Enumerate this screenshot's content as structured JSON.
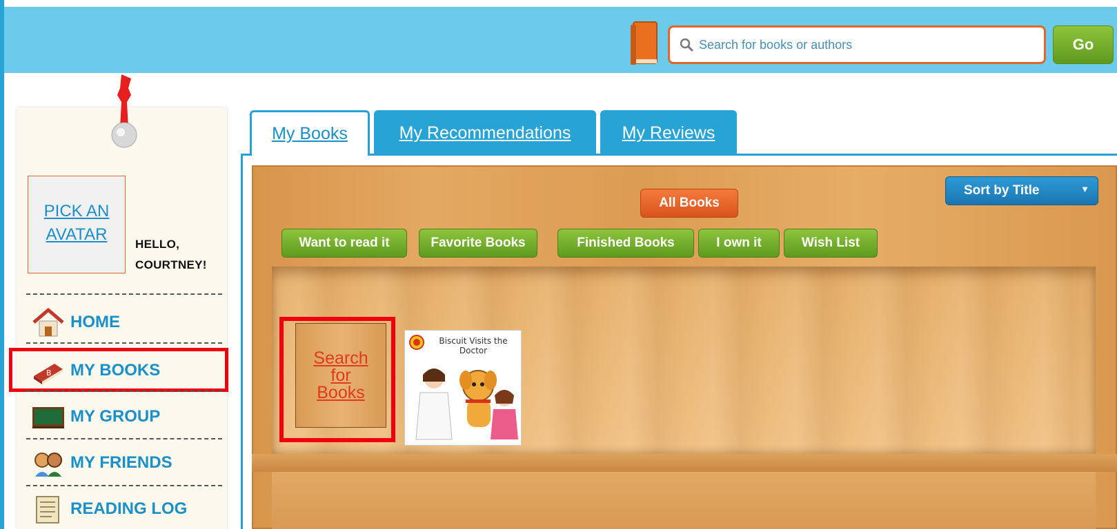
{
  "header": {
    "search_placeholder": "Search for books or authors",
    "go_label": "Go"
  },
  "sidebar": {
    "avatar_link": "PICK AN AVATAR",
    "greeting_line1": "HELLO,",
    "greeting_line2": "COURTNEY!",
    "items": [
      {
        "label": "HOME",
        "icon": "house-icon"
      },
      {
        "label": "MY BOOKS",
        "icon": "book-icon"
      },
      {
        "label": "MY GROUP",
        "icon": "chalkboard-icon"
      },
      {
        "label": "MY FRIENDS",
        "icon": "friends-icon"
      },
      {
        "label": "READING LOG",
        "icon": "scroll-icon"
      }
    ]
  },
  "tabs": [
    {
      "label": "My Books",
      "active": true
    },
    {
      "label": "My Recommendations",
      "active": false
    },
    {
      "label": "My Reviews",
      "active": false
    }
  ],
  "shelf": {
    "all_books_label": "All Books",
    "filters": [
      "Want to read it",
      "Favorite Books",
      "Finished Books",
      "I own it",
      "Wish List"
    ],
    "sort_label": "Sort by Title",
    "search_books_link": "Search for Books",
    "books": [
      {
        "title": "Biscuit Visits the Doctor"
      }
    ]
  },
  "colors": {
    "header_bg": "#6ccbeb",
    "accent_blue": "#1b8fc7",
    "orange": "#e0662a",
    "green": "#6fae2a",
    "highlight_red": "#f0000f"
  }
}
